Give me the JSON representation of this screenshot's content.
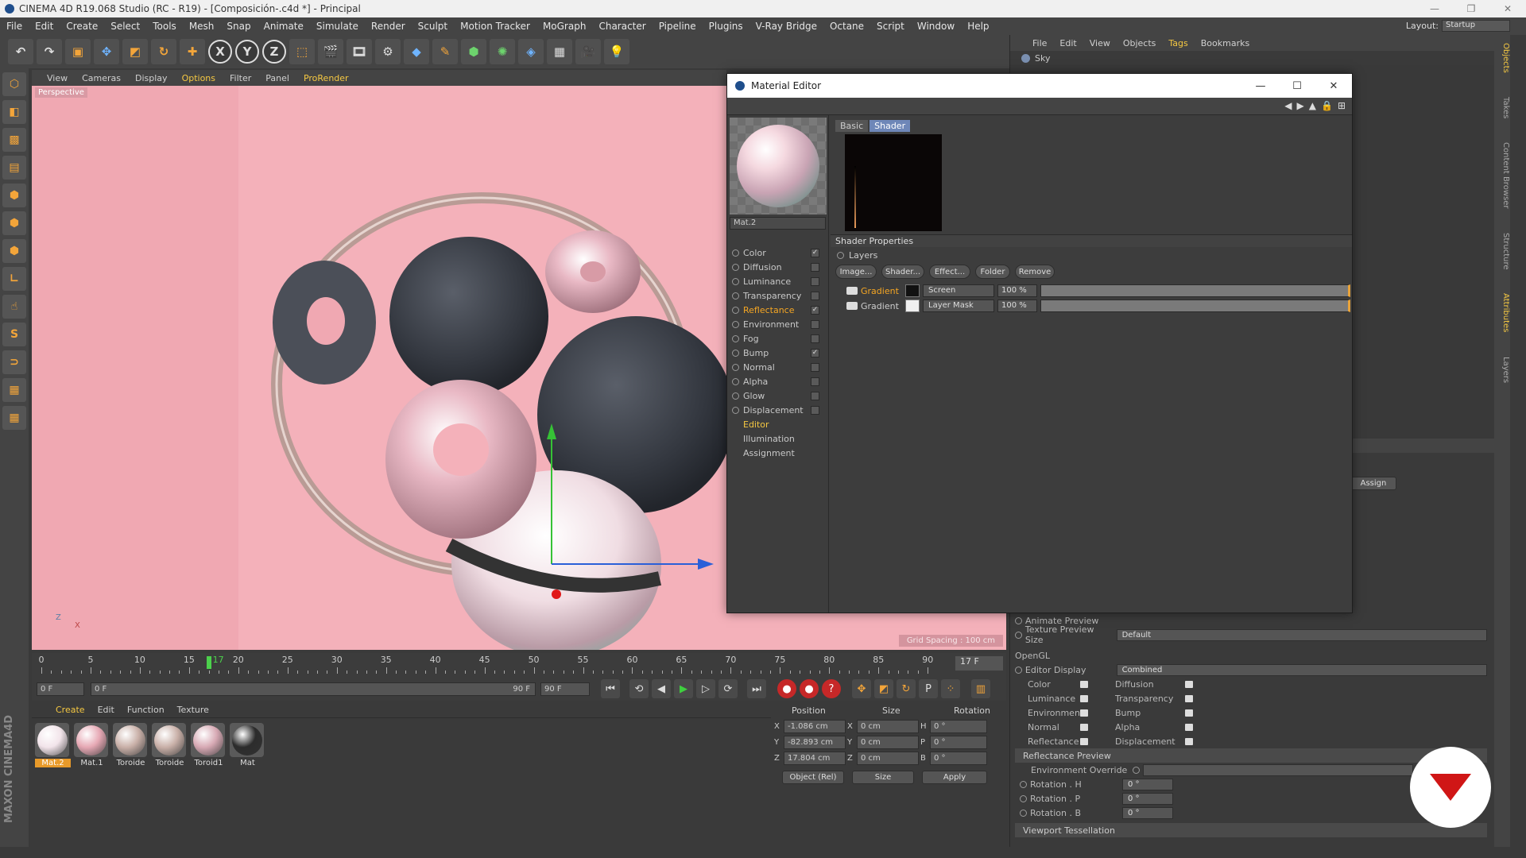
{
  "app": {
    "title": "CINEMA 4D R19.068 Studio (RC - R19) - [Composición-.c4d *] - Principal",
    "layout_label": "Layout:",
    "layout_value": "Startup"
  },
  "menubar": [
    "File",
    "Edit",
    "Create",
    "Select",
    "Tools",
    "Mesh",
    "Snap",
    "Animate",
    "Simulate",
    "Render",
    "Sculpt",
    "Motion Tracker",
    "MoGraph",
    "Character",
    "Pipeline",
    "Plugins",
    "V-Ray Bridge",
    "Octane",
    "Script",
    "Window",
    "Help"
  ],
  "toolbar": {
    "axis_x": "X",
    "axis_y": "Y",
    "axis_z": "Z"
  },
  "viewport": {
    "menu": [
      "View",
      "Cameras",
      "Display",
      "Options",
      "Filter",
      "Panel",
      "ProRender"
    ],
    "label": "Perspective",
    "grid_spacing": "Grid Spacing : 100 cm",
    "axis_z": "Z",
    "axis_x": "X"
  },
  "timeline": {
    "ticks": [
      "0",
      "5",
      "10",
      "15",
      "20",
      "25",
      "30",
      "35",
      "40",
      "45",
      "50",
      "55",
      "60",
      "65",
      "70",
      "75",
      "80",
      "85",
      "90"
    ],
    "current": "17",
    "frame_display": "17 F",
    "start_field": "0 F",
    "range_start": "0 F",
    "range_end": "90 F",
    "end_field": "90 F"
  },
  "material_manager": {
    "menu": [
      "Create",
      "Edit",
      "Function",
      "Texture"
    ],
    "materials": [
      {
        "name": "Mat.2",
        "selected": true,
        "color": "#f2e4ea"
      },
      {
        "name": "Mat.1",
        "selected": false,
        "color": "#e6a8b4"
      },
      {
        "name": "Toroide",
        "selected": false,
        "color": "#c9b0a8"
      },
      {
        "name": "Toroide",
        "selected": false,
        "color": "#c9b0a8"
      },
      {
        "name": "Toroid1",
        "selected": false,
        "color": "#d7a9b4"
      },
      {
        "name": "Mat",
        "selected": false,
        "color": "#2c2c2c"
      }
    ],
    "maxon_brand": "MAXON CINEMA4D"
  },
  "coordinates": {
    "headers": [
      "Position",
      "Size",
      "Rotation"
    ],
    "rows": [
      {
        "axis": "X",
        "pos": "-1.086 cm",
        "size_axis": "X",
        "size": "0 cm",
        "rot_axis": "H",
        "rot": "0 °"
      },
      {
        "axis": "Y",
        "pos": "-82.893 cm",
        "size_axis": "Y",
        "size": "0 cm",
        "rot_axis": "P",
        "rot": "0 °"
      },
      {
        "axis": "Z",
        "pos": "17.804 cm",
        "size_axis": "Z",
        "size": "0 cm",
        "rot_axis": "B",
        "rot": "0 °"
      }
    ],
    "mode": "Object (Rel)",
    "size_mode": "Size",
    "apply": "Apply"
  },
  "object_manager": {
    "menu": [
      "File",
      "Edit",
      "View",
      "Objects",
      "Tags",
      "Bookmarks"
    ],
    "objects": [
      "Sky"
    ]
  },
  "attributes": {
    "assign": "Assign",
    "animate_preview": "Animate Preview",
    "texture_preview_size_label": "Texture Preview Size",
    "texture_preview_size": "Default",
    "opengl": "OpenGL",
    "editor_display_label": "Editor Display",
    "editor_display": "Combined",
    "channels_left": [
      "Color",
      "Luminance",
      "Environment",
      "Normal",
      "Reflectance"
    ],
    "channels_right": [
      "Diffusion",
      "Transparency",
      "Bump",
      "Alpha",
      "Displacement"
    ],
    "reflectance_preview": "Reflectance Preview",
    "environment_override": "Environment Override",
    "rotation_h_label": "Rotation . H",
    "rotation_h": "0 °",
    "rotation_p_label": "Rotation . P",
    "rotation_p": "0 °",
    "rotation_b_label": "Rotation . B",
    "rotation_b": "0 °",
    "viewport_tessellation": "Viewport Tessellation",
    "side_tabs": [
      "Objects",
      "Takes",
      "Content Browser",
      "Structure",
      "Attributes",
      "Layers"
    ]
  },
  "material_editor": {
    "title": "Material Editor",
    "material_name": "Mat.2",
    "channels": [
      {
        "name": "Color",
        "checked": true
      },
      {
        "name": "Diffusion",
        "checked": false
      },
      {
        "name": "Luminance",
        "checked": false
      },
      {
        "name": "Transparency",
        "checked": false
      },
      {
        "name": "Reflectance",
        "checked": true
      },
      {
        "name": "Environment",
        "checked": false
      },
      {
        "name": "Fog",
        "checked": false
      },
      {
        "name": "Bump",
        "checked": true
      },
      {
        "name": "Normal",
        "checked": false
      },
      {
        "name": "Alpha",
        "checked": false
      },
      {
        "name": "Glow",
        "checked": false
      },
      {
        "name": "Displacement",
        "checked": false
      }
    ],
    "extra": [
      "Editor",
      "Illumination",
      "Assignment"
    ],
    "tabs": [
      "Basic",
      "Shader"
    ],
    "shader_properties": "Shader Properties",
    "layers_label": "Layers",
    "buttons": [
      "Image...",
      "Shader...",
      "Effect...",
      "Folder",
      "Remove"
    ],
    "layers": [
      {
        "name": "Gradient",
        "mode": "Screen",
        "percent": "100 %",
        "swatch": "#111111"
      },
      {
        "name": "Gradient",
        "mode": "Layer Mask",
        "percent": "100 %",
        "swatch": "#f0f0f0"
      }
    ]
  }
}
